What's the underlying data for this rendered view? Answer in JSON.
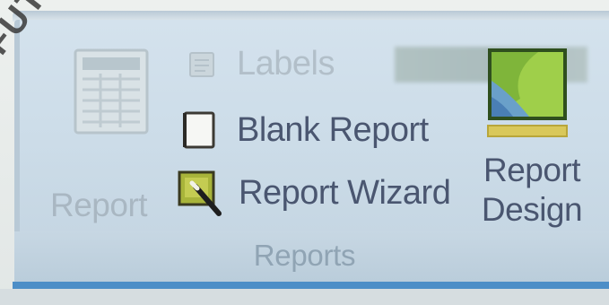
{
  "watermark": "FUTURE",
  "group": {
    "title": "Reports",
    "buttons": {
      "report": {
        "label": "Report",
        "icon": "report-table-icon",
        "enabled": false
      },
      "labels": {
        "label": "Labels",
        "icon": "labels-icon",
        "enabled": false
      },
      "blank_report": {
        "label": "Blank Report",
        "icon": "blank-report-icon",
        "enabled": true
      },
      "report_wizard": {
        "label": "Report Wizard",
        "icon": "report-wizard-icon",
        "enabled": true
      },
      "report_design": {
        "label_line1": "Report",
        "label_line2": "Design",
        "icon": "report-design-icon",
        "enabled": true
      }
    }
  },
  "colors": {
    "ribbon_bg": "#cddde9",
    "label_enabled": "#4a5670",
    "label_disabled": "#a9b7c2",
    "accent_bottom": "#4c8ec7"
  }
}
